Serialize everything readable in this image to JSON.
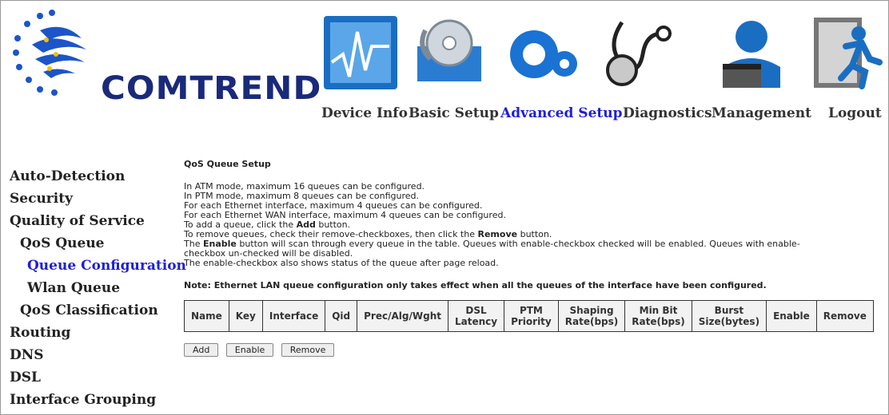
{
  "brand": {
    "name": "COMTREND"
  },
  "nav": [
    {
      "label": "Device Info",
      "icon": "monitor-chart-icon"
    },
    {
      "label": "Basic Setup",
      "icon": "disc-setup-icon"
    },
    {
      "label": "Advanced Setup",
      "icon": "gears-icon",
      "active": true
    },
    {
      "label": "Diagnostics",
      "icon": "stethoscope-icon"
    },
    {
      "label": "Management",
      "icon": "user-card-icon"
    },
    {
      "label": "Logout",
      "icon": "exit-runner-icon"
    }
  ],
  "sidebar": {
    "items": [
      {
        "label": "Auto-Detection"
      },
      {
        "label": "Security"
      },
      {
        "label": "Quality of Service"
      },
      {
        "label": "QoS Queue"
      },
      {
        "label": "Queue Configuration"
      },
      {
        "label": "Wlan Queue"
      },
      {
        "label": "QoS Classification"
      },
      {
        "label": "Routing"
      },
      {
        "label": "DNS"
      },
      {
        "label": "DSL"
      },
      {
        "label": "Interface Grouping"
      }
    ]
  },
  "main": {
    "title": "QoS Queue Setup",
    "lines": [
      "In ATM mode, maximum 16 queues can be configured.",
      "In PTM mode, maximum 8 queues can be configured.",
      "For each Ethernet interface, maximum 4 queues can be configured.",
      "For each Ethernet WAN interface, maximum 4 queues can be configured."
    ],
    "add_line": {
      "pre": "To add a queue, click the ",
      "bold": "Add",
      "post": " button."
    },
    "remove_line": {
      "pre": "To remove queues, check their remove-checkboxes, then click the ",
      "bold": "Remove",
      "post": " button."
    },
    "enable_line": {
      "pre": "The ",
      "bold": "Enable",
      "post": " button will scan through every queue in the table. Queues with enable-checkbox checked will be enabled. Queues with enable-"
    },
    "enable_line2": "checkbox un-checked will be disabled.",
    "status_line": "The enable-checkbox also shows status of the queue after page reload.",
    "note": "Note: Ethernet LAN queue configuration only takes effect when all the queues of the interface have been configured.",
    "table": {
      "headers": [
        [
          "Name"
        ],
        [
          "Key"
        ],
        [
          "Interface"
        ],
        [
          "Qid"
        ],
        [
          "Prec/Alg/Wght"
        ],
        [
          "DSL",
          "Latency"
        ],
        [
          "PTM",
          "Priority"
        ],
        [
          "Shaping",
          "Rate(bps)"
        ],
        [
          "Min Bit",
          "Rate(bps)"
        ],
        [
          "Burst",
          "Size(bytes)"
        ],
        [
          "Enable"
        ],
        [
          "Remove"
        ]
      ]
    },
    "buttons": {
      "add": "Add",
      "enable": "Enable",
      "remove": "Remove"
    }
  }
}
